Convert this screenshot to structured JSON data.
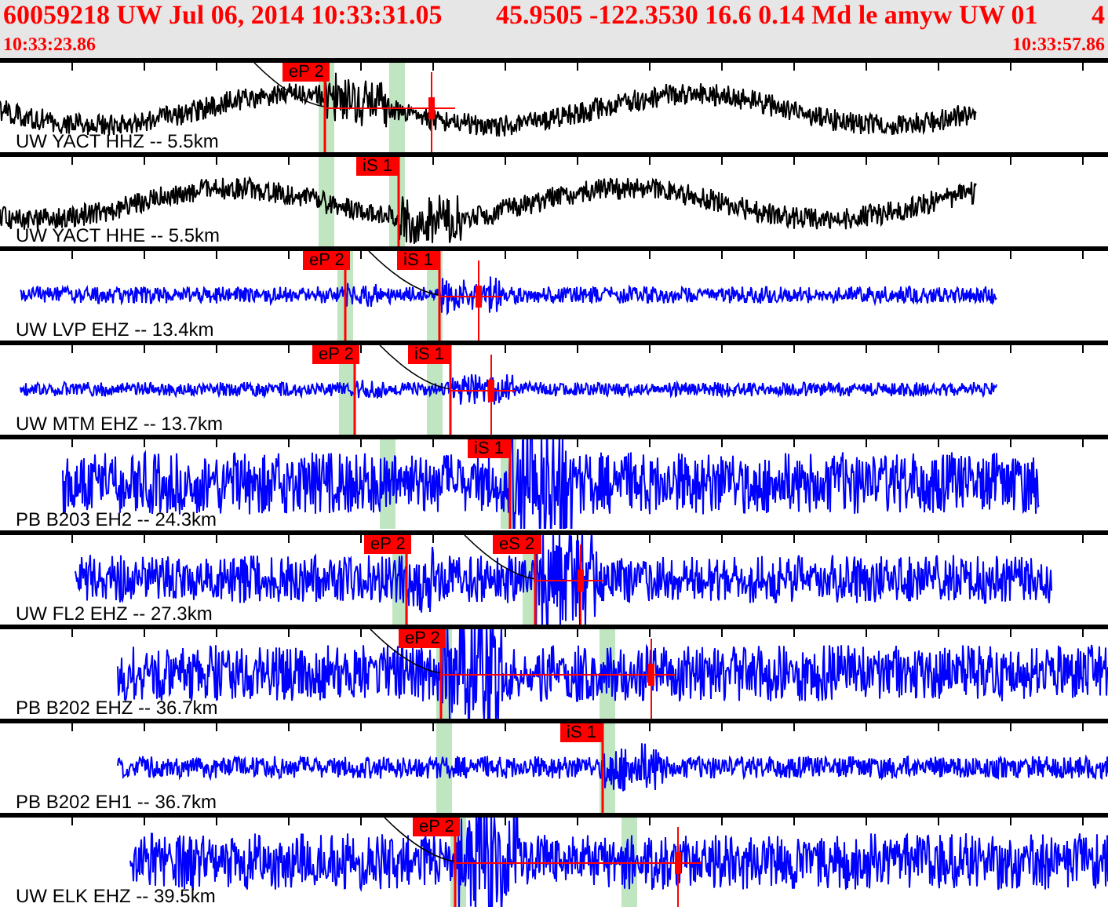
{
  "header": {
    "event": "60059218 UW Jul 06, 2014 10:33:31.05",
    "location": "45.9505 -122.3530 16.6 0.14 Md le amyw UW 01",
    "count": "4",
    "start_time": "10:33:23.86",
    "end_time": "10:33:57.86"
  },
  "traces": [
    {
      "label": "UW YACT HHZ -- 5.5km",
      "color": "#000000",
      "picks": [
        {
          "label": "eP 2"
        }
      ]
    },
    {
      "label": "UW YACT HHE -- 5.5km",
      "color": "#000000",
      "picks": [
        {
          "label": "iS 1"
        }
      ]
    },
    {
      "label": "UW LVP EHZ -- 13.4km",
      "color": "#0000ff",
      "picks": [
        {
          "label": "eP 2"
        },
        {
          "label": "iS 1"
        }
      ]
    },
    {
      "label": "UW MTM EHZ -- 13.7km",
      "color": "#0000ff",
      "picks": [
        {
          "label": "eP 2"
        },
        {
          "label": "iS 1"
        }
      ]
    },
    {
      "label": "PB B203 EH2 -- 24.3km",
      "color": "#0000ff",
      "picks": [
        {
          "label": "iS 1"
        }
      ]
    },
    {
      "label": "UW FL2 EHZ -- 27.3km",
      "color": "#0000ff",
      "picks": [
        {
          "label": "eP 2"
        },
        {
          "label": "eS 2"
        }
      ]
    },
    {
      "label": "PB B202 EHZ -- 36.7km",
      "color": "#0000ff",
      "picks": [
        {
          "label": "eP 2"
        }
      ]
    },
    {
      "label": "PB B202 EH1 -- 36.7km",
      "color": "#0000ff",
      "picks": [
        {
          "label": "iS 1"
        }
      ]
    },
    {
      "label": "UW ELK EHZ -- 39.5km",
      "color": "#0000ff",
      "picks": [
        {
          "label": "eP 2"
        }
      ]
    }
  ]
}
